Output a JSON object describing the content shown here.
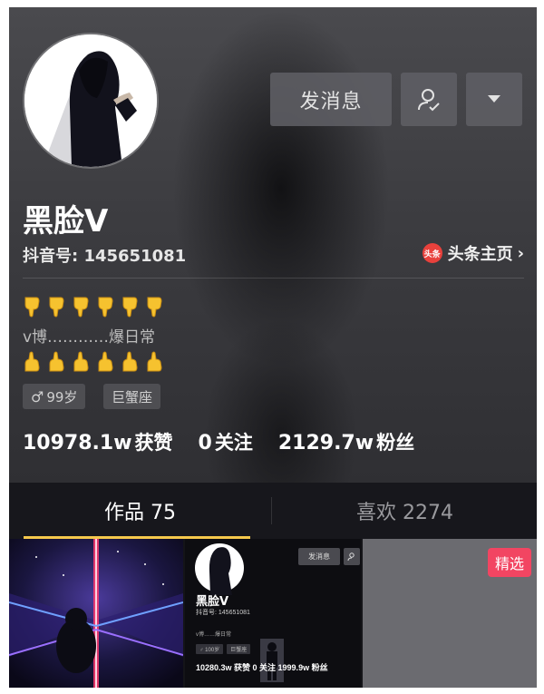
{
  "profile": {
    "name": "黑脸V",
    "douyin_id": "抖音号: 145651081",
    "toutiao_badge": "头条",
    "toutiao_link": "头条主页",
    "bio": "v博…………爆日常",
    "gender_symbol": "♂",
    "age": "99岁",
    "zodiac": "巨蟹座"
  },
  "actions": {
    "message_label": "发消息",
    "follow_icon": "user-check-icon",
    "more_icon": "caret-down-icon"
  },
  "stats": {
    "likes_value": "10978.1w",
    "likes_label": "获赞",
    "following_value": "0",
    "following_label": "关注",
    "followers_value": "2129.7w",
    "followers_label": "粉丝"
  },
  "tabs": {
    "works_label": "作品 75",
    "likes_label": "喜欢 2274"
  },
  "thumbnails": {
    "thumb2": {
      "name": "黑脸V",
      "id": "抖音号: 145651081",
      "bio": "v博……爆日常",
      "tag_age": "♂ 100岁",
      "tag_zodiac": "巨蟹座",
      "message_label": "发消息",
      "stats": "10280.3w 获赞 0 关注 1999.9w 粉丝"
    },
    "thumb3": {
      "badge": "精选"
    }
  },
  "colors": {
    "tab_underline": "#f5c84c",
    "featured_badge": "#f24562",
    "toutiao_badge": "#e8413c"
  }
}
